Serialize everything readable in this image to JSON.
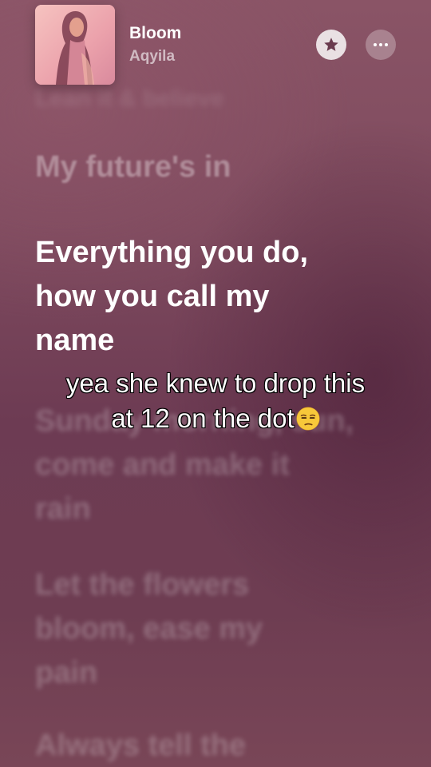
{
  "now_playing": {
    "title": "Bloom",
    "artist": "Aqyila",
    "album_art_icon": "album-cover-portrait"
  },
  "controls": {
    "favorite_icon": "star-icon",
    "more_icon": "ellipsis-icon"
  },
  "lyrics": {
    "previous_partial": "Lean it & believe",
    "line_1": "My future's in",
    "active": [
      "Everything you do,",
      "how you call my",
      "name"
    ],
    "next_1": [
      "Sunday morning, sun,",
      "come and make it",
      "rain"
    ],
    "next_2": [
      "Let the flowers",
      "bloom, ease my",
      "pain"
    ],
    "next_3": "Always tell the"
  },
  "caption": {
    "line_1": "yea she knew to drop this",
    "line_2": "at 12 on the dot",
    "emoji": "unamused-face"
  },
  "colors": {
    "background_top": "#8a5466",
    "background_mid": "#6d3b53",
    "lyric_active": "#ffffff"
  }
}
